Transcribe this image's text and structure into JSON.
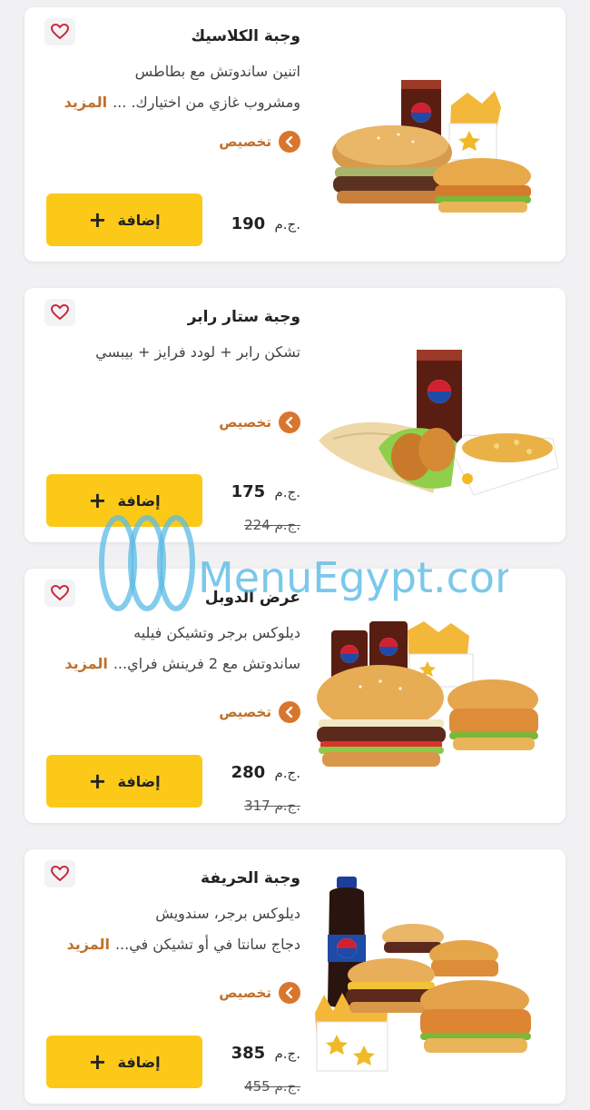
{
  "items": [
    {
      "title": "وجبة الكلاسيك",
      "desc_lines": [
        "اتنين ساندوتش مع بطاطس",
        "ومشروب غازي من اختيارك. ..."
      ],
      "more_label": "المزيد",
      "customize_label": "تخصيص",
      "price": "190",
      "currency": "ج.م.",
      "old_price": "",
      "add_label": "إضافة",
      "image": "burger-combo"
    },
    {
      "title": "وجبة ستار رابر",
      "desc_lines": [
        "تشكن رابر + لودد فرايز + بيبسي"
      ],
      "more_label": "",
      "customize_label": "تخصيص",
      "price": "175",
      "currency": "ج.م.",
      "old_price": "224 ج.م.",
      "add_label": "إضافة",
      "image": "wrap-combo"
    },
    {
      "title": "عرض الدوبل",
      "desc_lines": [
        "ديلوكس برجر وتشيكن فيليه",
        "ساندوتش مع 2 فرينش فراي..."
      ],
      "more_label": "المزيد",
      "customize_label": "تخصيص",
      "price": "280",
      "currency": "ج.م.",
      "old_price": "317 ج.م.",
      "add_label": "إضافة",
      "image": "double-combo"
    },
    {
      "title": "وجبة الحريفة",
      "desc_lines": [
        "ديلوكس برجر، سندويش",
        "دجاج سانتا في أو تشيكن في..."
      ],
      "more_label": "المزيد",
      "customize_label": "تخصيص",
      "price": "385",
      "currency": "ج.م.",
      "old_price": "455 ج.م.",
      "add_label": "إضافة",
      "image": "spicy-family-combo"
    }
  ],
  "watermark": "MenuEgypt.com",
  "colors": {
    "accent_yellow": "#fcc919",
    "accent_orange": "#c0702a",
    "background": "#f1f1f3"
  },
  "icons": {
    "favorite": "heart-icon",
    "customize": "chevron-left-icon",
    "add": "plus-icon"
  }
}
